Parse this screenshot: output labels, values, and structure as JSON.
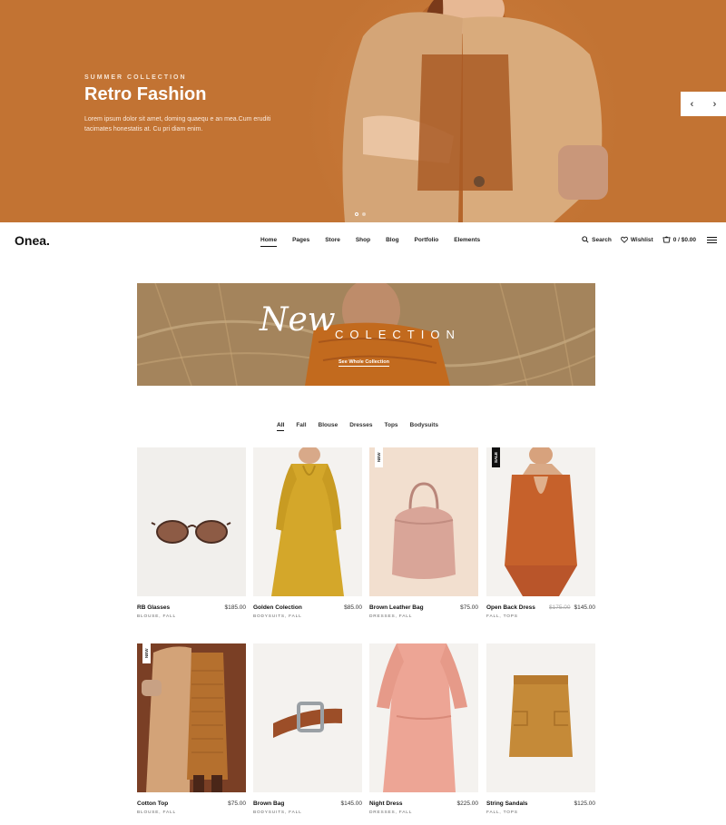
{
  "hero": {
    "eyebrow": "SUMMER COLLECTION",
    "title": "Retro Fashion",
    "text": "Lorem ipsum dolor sit amet, doming quaequ e an mea.Cum eruditi tacimates honestatis at. Cu pri diam enim.",
    "prev_icon": "‹",
    "next_icon": "›",
    "accent": "#c27333"
  },
  "nav": {
    "logo": "Onea.",
    "items": [
      "Home",
      "Pages",
      "Store",
      "Shop",
      "Blog",
      "Portfolio",
      "Elements"
    ],
    "active": "Home",
    "search": "Search",
    "wishlist": "Wishlist",
    "cart": "0 / $0.00"
  },
  "banner": {
    "script": "New",
    "word": "COLECTION",
    "link": "See Whole Collection"
  },
  "filters": {
    "items": [
      "All",
      "Fall",
      "Blouse",
      "Dresses",
      "Tops",
      "Bodysuits"
    ],
    "active": "All"
  },
  "products": [
    {
      "name": "RB Glasses",
      "price": "$185.00",
      "old_price": "",
      "cats": "BLOUSE, FALL",
      "badge": ""
    },
    {
      "name": "Golden Colection",
      "price": "$85.00",
      "old_price": "",
      "cats": "BODYSUITS, FALL",
      "badge": ""
    },
    {
      "name": "Brown Leather Bag",
      "price": "$75.00",
      "old_price": "",
      "cats": "DRESSES, FALL",
      "badge": "NEW"
    },
    {
      "name": "Open Back Dress",
      "price": "$145.00",
      "old_price": "$175.00",
      "cats": "FALL, TOPS",
      "badge": "SALE"
    },
    {
      "name": "Cotton Top",
      "price": "$75.00",
      "old_price": "",
      "cats": "BLOUSE, FALL",
      "badge": "NEW"
    },
    {
      "name": "Brown Bag",
      "price": "$145.00",
      "old_price": "",
      "cats": "BODYSUITS, FALL",
      "badge": ""
    },
    {
      "name": "Night Dress",
      "price": "$225.00",
      "old_price": "",
      "cats": "DRESSES, FALL",
      "badge": ""
    },
    {
      "name": "String Sandals",
      "price": "$125.00",
      "old_price": "",
      "cats": "FALL, TOPS",
      "badge": ""
    }
  ]
}
